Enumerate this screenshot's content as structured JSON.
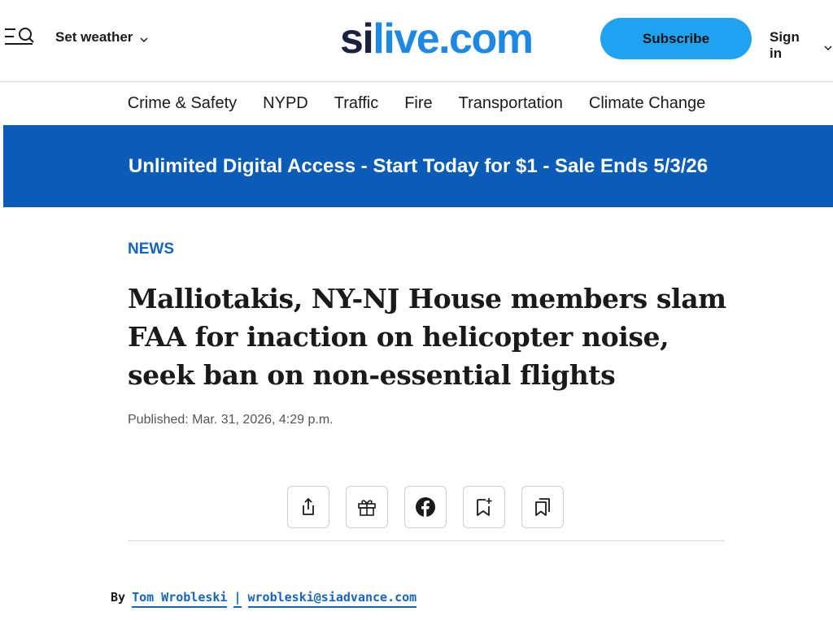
{
  "header": {
    "menu_icon": "menu-search-icon",
    "weather_label": "Set weather",
    "logo": {
      "part1": "si",
      "part2": "live.com"
    },
    "subscribe_label": "Subscribe",
    "signin_label": "Sign in"
  },
  "nav": {
    "items": [
      {
        "label": "Crime & Safety"
      },
      {
        "label": "NYPD"
      },
      {
        "label": "Traffic"
      },
      {
        "label": "Fire"
      },
      {
        "label": "Transportation"
      },
      {
        "label": "Climate Change"
      }
    ]
  },
  "banner": {
    "text": "Unlimited Digital Access - Start Today for $1 - Sale Ends 5/3/26"
  },
  "article": {
    "section": "NEWS",
    "headline": "Malliotakis, NY-NJ House members slam FAA for inaction on helicopter noise, seek ban on non-essential flights",
    "published": "Published: Mar. 31, 2026, 4:29 p.m.",
    "share_buttons": [
      {
        "icon": "share-icon"
      },
      {
        "icon": "gift-icon"
      },
      {
        "icon": "facebook-icon"
      },
      {
        "icon": "bookmark-add-icon"
      },
      {
        "icon": "saved-bookmarks-icon"
      }
    ],
    "byline": {
      "prefix": "By",
      "author": "Tom Wrobleski",
      "separator": "|",
      "email": "wrobleski@siadvance.com"
    }
  },
  "colors": {
    "brand_dark": "#1b2240",
    "brand_blue": "#1e88e5",
    "subscribe_bg": "#1fa3f0",
    "banner_bg": "#0b5cb8",
    "link_blue": "#1565c0"
  }
}
